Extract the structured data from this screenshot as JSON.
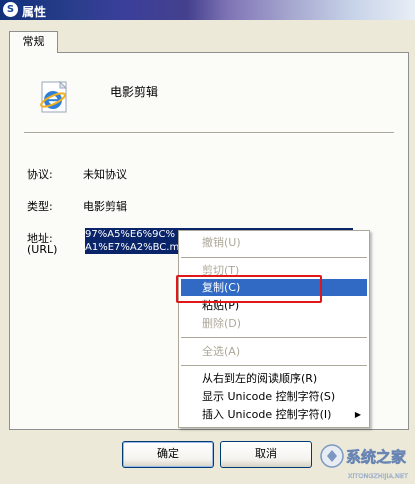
{
  "window": {
    "title": "属性",
    "app_icon": "s-badge-icon"
  },
  "tabs": [
    {
      "label": "常规"
    }
  ],
  "file": {
    "name": "电影剪辑",
    "icon": "ie-icon"
  },
  "fields": [
    {
      "label": "协议:",
      "value": "未知协议"
    },
    {
      "label": "类型:",
      "value": "电影剪辑"
    }
  ],
  "address": {
    "label": "地址:",
    "sublabel": "(URL)",
    "line1": "97%A5%E6%9C%",
    "line2": "A1%E7%A2%BC.m"
  },
  "context_menu": {
    "items": [
      {
        "label": "撤销(U)",
        "enabled": false
      },
      {
        "label": "剪切(T)",
        "enabled": false
      },
      {
        "label": "复制(C)",
        "enabled": true,
        "selected": true
      },
      {
        "label": "粘贴(P)",
        "enabled": true
      },
      {
        "label": "删除(D)",
        "enabled": false
      },
      {
        "label": "全选(A)",
        "enabled": false
      },
      {
        "label": "从右到左的阅读顺序(R)",
        "enabled": true
      },
      {
        "label": "显示 Unicode 控制字符(S)",
        "enabled": true
      },
      {
        "label": "插入 Unicode 控制字符(I)",
        "enabled": true,
        "submenu": true
      }
    ]
  },
  "buttons": {
    "ok": "确定",
    "cancel": "取消"
  },
  "watermark": {
    "brand": "系统之家",
    "url": "XITONGZHIJIA.NET"
  },
  "colors": {
    "selection": "#0a246a",
    "menu_highlight": "#316ac5",
    "annotation": "#e0181a"
  }
}
